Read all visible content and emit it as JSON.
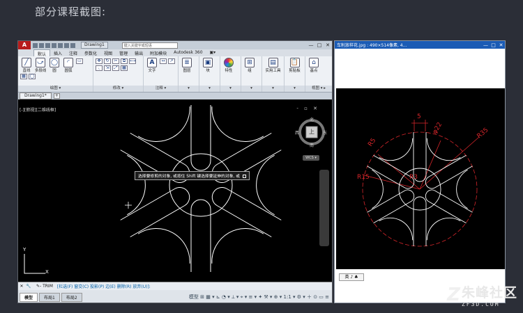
{
  "heading": "部分课程截图:",
  "cad": {
    "app_logo": "A",
    "doc_title": "Drawing1",
    "search_placeholder": "键入关键字或短语",
    "win_controls": [
      "—",
      "□",
      "✕"
    ],
    "ribbon_tabs": [
      "默认",
      "插入",
      "注释",
      "参数化",
      "视图",
      "管理",
      "输出",
      "附加模块",
      "Autodesk 360",
      "▣▾"
    ],
    "ribbon_active_tab": 0,
    "tools": {
      "line": "直线",
      "polyline": "多段线",
      "circle": "圆",
      "arc": "圆弧",
      "text": "文字",
      "layer_props": "图层",
      "block": "块",
      "properties": "特性",
      "group": "组",
      "utilities": "实用工具",
      "clipboard": "剪贴板",
      "base": "基点"
    },
    "group_labels": {
      "draw": "绘图 ▾",
      "modify": "修改 ▾",
      "annotation": "注释 ▾",
      "view": "视图 ▾ ▸"
    },
    "file_tab": "Drawing1*",
    "add_tab": "+",
    "view_label": "[-][俯视][二维线框]",
    "viewport_controls": "- ▫ ✕",
    "viewcube": {
      "top": "上",
      "n": "北",
      "s": "南",
      "e": "东",
      "w": "西",
      "wcs": "WCS ▾"
    },
    "tooltip": "选择要修剪的对象, 或按住 Shift 键选择要延伸的对象, 或",
    "ucs": {
      "y": "Y",
      "x": "X"
    },
    "command": {
      "close": "✕",
      "wrench": "🔧",
      "prompt": "✎- TRIM",
      "options": "[栏选(F) 窗交(C) 投影(P) 边(E) 删除(R) 放弃(U)]:"
    },
    "layout_tabs": [
      "模型",
      "布局1",
      "布局2"
    ],
    "layout_active": 0,
    "status_icons": "模型 ⊞ ▦ ▾ ⊾ ◔ ▾ ⟂ ▾ ⌖ ▾ ≡ ▾ ✦ ⚒ ▾ ⊕ ▾ 1:1 ▾ ⚙ ▾ ＋ ⊙ ▭ ≡"
  },
  "viewer": {
    "title": "车削放样花.jpg : 490×514像素, 4...",
    "win_controls": [
      "—",
      "□",
      "✕"
    ],
    "dims": {
      "r5_top": "R5",
      "five": "5",
      "phi22": "φ22",
      "r35": "R35",
      "r15": "R15",
      "r3": "R3"
    },
    "ime": "英 ♪ ♣"
  },
  "watermark": {
    "mark": "Z",
    "brand": "朱峰社区",
    "url": "ZF3D.COM"
  },
  "colors": {
    "background": "#2b2e37",
    "cad_canvas": "#000000",
    "accent_red": "#b71c1c",
    "dim_red": "#d8262b",
    "viewer_title": "#1a5bb5"
  }
}
